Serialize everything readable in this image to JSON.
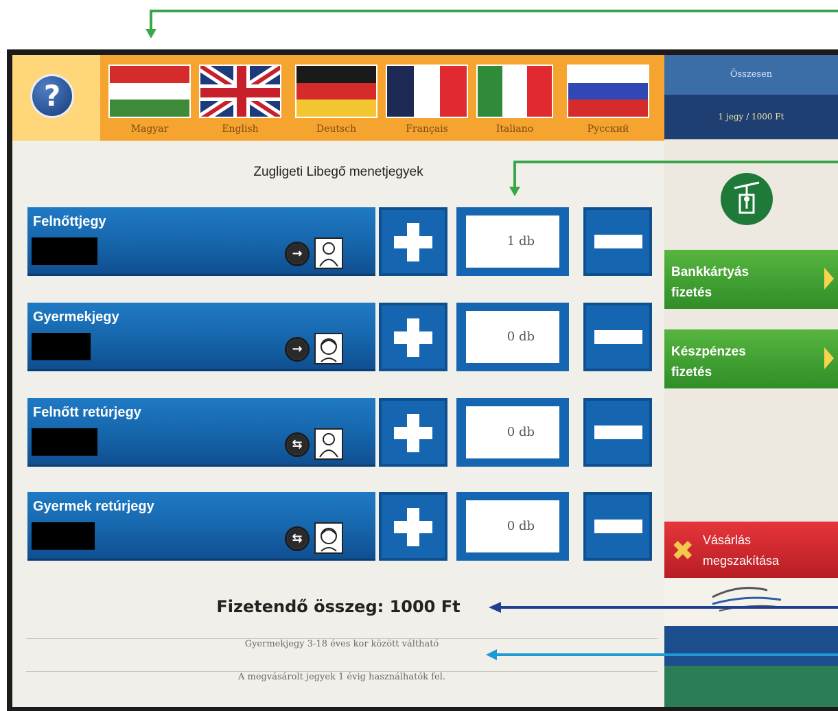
{
  "header": {
    "help_icon": "question-mark",
    "languages": [
      {
        "label": "Magyar",
        "code": "hu"
      },
      {
        "label": "English",
        "code": "en"
      },
      {
        "label": "Deutsch",
        "code": "de"
      },
      {
        "label": "Français",
        "code": "fr"
      },
      {
        "label": "Italiano",
        "code": "it"
      },
      {
        "label": "Русский",
        "code": "ru"
      }
    ]
  },
  "sidebar": {
    "top_label": "Összesen",
    "price_info": "1 jegy / 1000 Ft",
    "icon": "chairlift-icon",
    "card_payment": {
      "line1": "Bankkártyás",
      "line2": "fizetés"
    },
    "cash_payment": {
      "line1": "Készpénzes",
      "line2": "fizetés"
    },
    "cancel": {
      "line1": "Vásárlás",
      "line2": "megszakítása"
    }
  },
  "main": {
    "title": "Zugligeti Libegő menetjegyek",
    "tickets": [
      {
        "name": "Felnőttjegy",
        "qty": "1 db",
        "direction": "one-way",
        "person": "adult"
      },
      {
        "name": "Gyermekjegy",
        "qty": "0 db",
        "direction": "one-way",
        "person": "child"
      },
      {
        "name": "Felnőtt retúrjegy",
        "qty": "0 db",
        "direction": "return",
        "person": "adult"
      },
      {
        "name": "Gyermek retúrjegy",
        "qty": "0 db",
        "direction": "return",
        "person": "child"
      }
    ],
    "total": "Fizetendő összeg: 1000 Ft",
    "info1": "Gyermekjegy 3-18 éves kor között váltható",
    "info2": "A megvásárolt jegyek 1 évig használhatók fel."
  },
  "colors": {
    "annotation_green": "#3aa64a",
    "annotation_darkblue": "#1f3f8f",
    "annotation_lightblue": "#1f9ad6",
    "ticket_blue": "#1767ad",
    "language_bar": "#f6a430"
  }
}
